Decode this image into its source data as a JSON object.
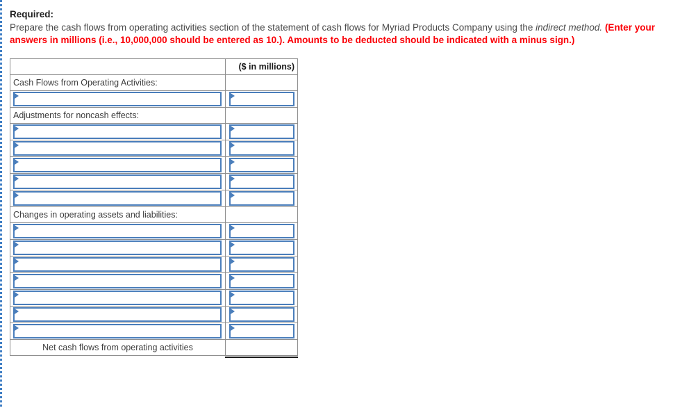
{
  "instructions": {
    "heading": "Required:",
    "line1": "Prepare the cash flows from operating activities section of the statement of cash flows for Myriad Products Company using the ",
    "line1_italic": "indirect method.",
    "line2_red": "(Enter your answers in millions (i.e., 10,000,000 should be entered as 10.). Amounts to be deducted should be indicated with a minus sign.)"
  },
  "worksheet": {
    "header": {
      "label_col": "",
      "value_col": "($ in millions)"
    },
    "sections": [
      {
        "label": "Cash Flows from Operating Activities:",
        "input_rows": 1
      },
      {
        "label": "Adjustments for noncash effects:",
        "input_rows": 5
      },
      {
        "label": "Changes in operating assets and liabilities:",
        "input_rows": 7
      }
    ],
    "total": {
      "label": "Net cash flows from operating activities",
      "value": ""
    },
    "input_placeholder": "",
    "row_marker_icon": "dropdown-triangle-icon"
  },
  "colors": {
    "header_blue": "#7cabdd",
    "input_border_blue": "#4a7ebb",
    "alert_red": "#fb0007",
    "grid_gray": "#8f8f8f",
    "page_edge_blue": "#3f7ec4"
  }
}
